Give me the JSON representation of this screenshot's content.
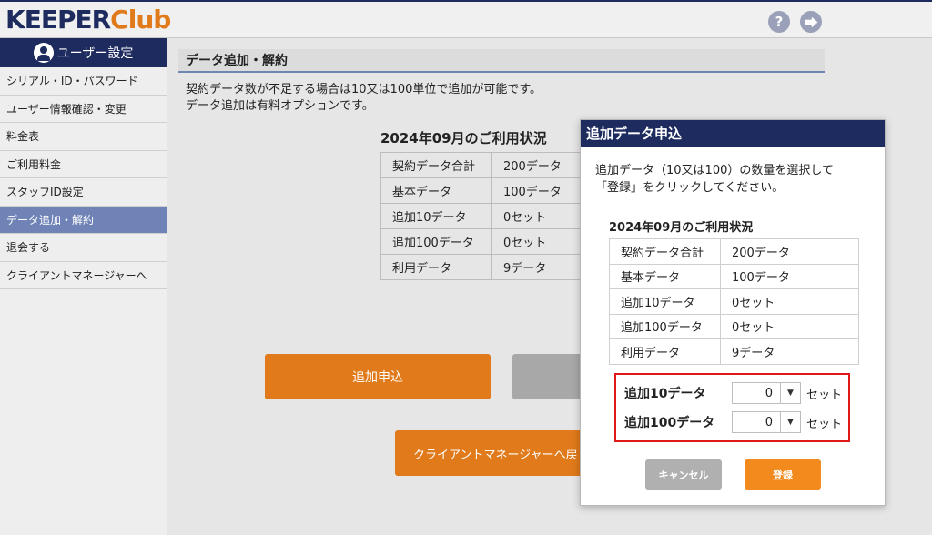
{
  "header": {
    "logo_keeper": "KEEPER",
    "logo_club": "Club",
    "help_icon": "?",
    "logout_icon": "⮕"
  },
  "sidebar": {
    "title": "ユーザー設定",
    "items": [
      {
        "label": "シリアル・ID・パスワード",
        "active": false
      },
      {
        "label": "ユーザー情報確認・変更",
        "active": false
      },
      {
        "label": "料金表",
        "active": false
      },
      {
        "label": "ご利用料金",
        "active": false
      },
      {
        "label": "スタッフID設定",
        "active": false
      },
      {
        "label": "データ追加・解約",
        "active": true
      },
      {
        "label": "退会する",
        "active": false
      },
      {
        "label": "クライアントマネージャーへ",
        "active": false
      }
    ]
  },
  "main": {
    "section_title": "データ追加・解約",
    "desc_line1": "契約データ数が不足する場合は10又は100単位で追加が可能です。",
    "desc_line2": "データ追加は有料オプションです。",
    "usage_title": "2024年09月のご利用状況",
    "usage_rows": [
      {
        "label": "契約データ合計",
        "value": "200データ"
      },
      {
        "label": "基本データ",
        "value": "100データ"
      },
      {
        "label": "追加10データ",
        "value": "0セット"
      },
      {
        "label": "追加100データ",
        "value": "0セット"
      },
      {
        "label": "利用データ",
        "value": "9データ"
      }
    ],
    "add_button": "追加申込",
    "client_manager_button": "クライアントマネージャーへ戻"
  },
  "modal": {
    "title": "追加データ申込",
    "desc_line1": "追加データ（10又は100）の数量を選択して",
    "desc_line2": "「登録」をクリックしてください。",
    "usage_title": "2024年09月のご利用状況",
    "usage_rows": [
      {
        "label": "契約データ合計",
        "value": "200データ"
      },
      {
        "label": "基本データ",
        "value": "100データ"
      },
      {
        "label": "追加10データ",
        "value": "0セット"
      },
      {
        "label": "追加100データ",
        "value": "0セット"
      },
      {
        "label": "利用データ",
        "value": "9データ"
      }
    ],
    "qty10_label": "追加10データ",
    "qty10_value": "0",
    "qty100_label": "追加100データ",
    "qty100_value": "0",
    "unit": "セット",
    "arrow": "▼",
    "cancel_button": "キャンセル",
    "register_button": "登録"
  },
  "colors": {
    "brand_navy": "#1d2b5e",
    "accent_orange": "#e07a1a",
    "active_nav": "#6f83b7",
    "highlight_red": "#e01818"
  }
}
